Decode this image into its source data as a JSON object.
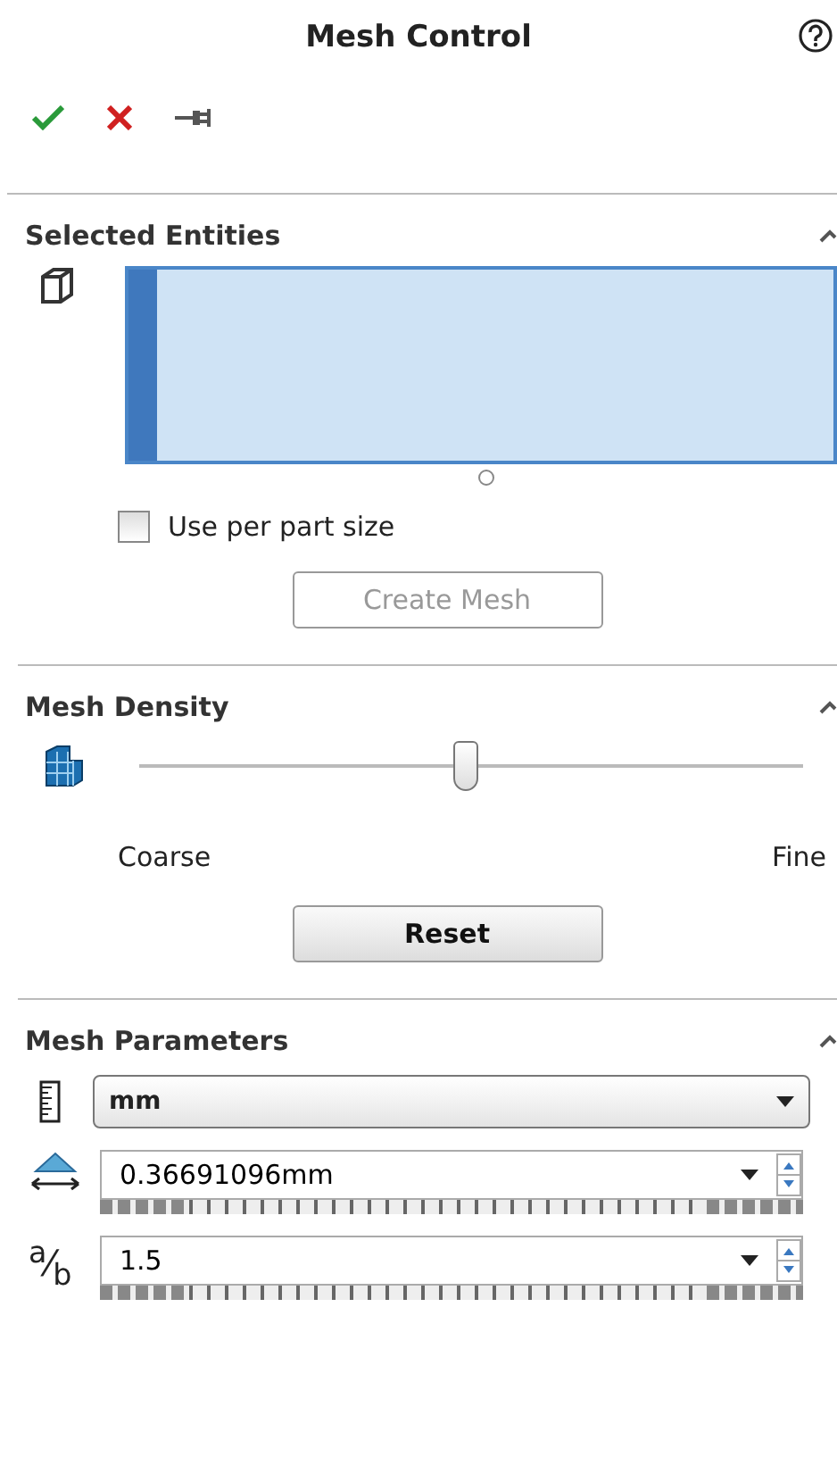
{
  "title": "Mesh Control",
  "selected_entities": {
    "heading": "Selected Entities",
    "expanded": true,
    "use_per_part_size": {
      "label": "Use per part size",
      "checked": false
    },
    "create_mesh": {
      "label": "Create Mesh",
      "disabled": true
    }
  },
  "mesh_density": {
    "heading": "Mesh Density",
    "expanded": true,
    "level": 0.49,
    "min_label": "Coarse",
    "max_label": "Fine",
    "reset": {
      "label": "Reset",
      "disabled": false
    }
  },
  "mesh_parameters": {
    "heading": "Mesh Parameters",
    "expanded": true,
    "unit": "mm",
    "fields": [
      {
        "kind": "size",
        "value": "0.36691096mm"
      },
      {
        "kind": "ratio",
        "symbol": "$^{a}$⁄$_{b}$",
        "value": "1.5"
      }
    ]
  }
}
